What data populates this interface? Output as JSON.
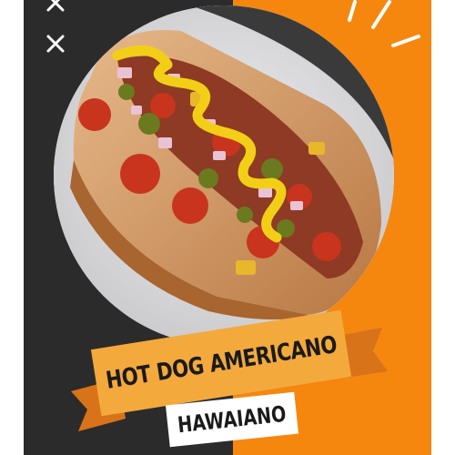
{
  "poster": {
    "title": "HOT DOG AMERICANO",
    "subtitle": "HAWAIANO",
    "colors": {
      "dark_panel": "#2b2b2b",
      "orange_panel": "#f5870f",
      "banner": "#f4a93d",
      "banner_shadow": "#d9731a",
      "mustard": "#f2cf16",
      "tomato": "#c8341d"
    },
    "decorations": {
      "dark_panel_icons": [
        "close-icon",
        "close-icon"
      ],
      "orange_panel_icon": "sparkle-rays-icon"
    },
    "photo": {
      "subject": "hot-dog-photo"
    }
  }
}
